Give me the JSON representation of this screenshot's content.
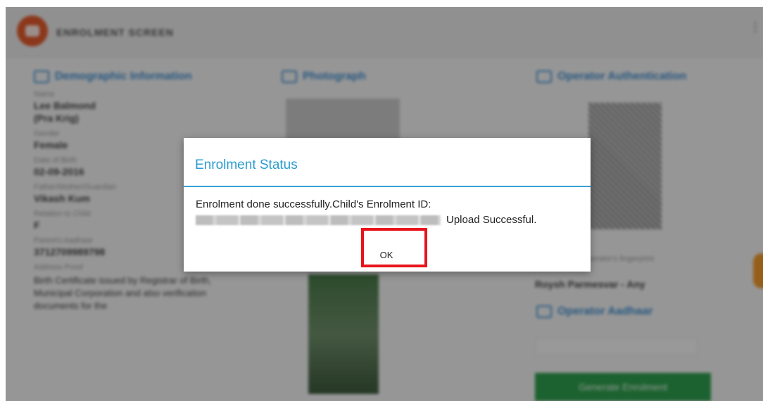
{
  "app": {
    "title": "ENROLMENT SCREEN"
  },
  "sections": {
    "demographic": {
      "heading": "Demographic Information",
      "fields": [
        {
          "label": "Name",
          "value": "Lee Balmond"
        },
        {
          "label": "",
          "value": "(Pra Krig)"
        },
        {
          "label": "Gender",
          "value": "Female"
        },
        {
          "label": "Date of Birth",
          "value": "02-09-2016"
        },
        {
          "label": "Father/Mother/Guardian",
          "value": "Vikash Kum"
        },
        {
          "label": "Relation to Child",
          "value": "F"
        },
        {
          "label": "Parent's Aadhaar",
          "value": "3712709989798"
        }
      ],
      "address_label": "Address Proof",
      "address_text": "Birth Certificate issued by Registrar of Birth, Municipal Corporation and also verification documents for the"
    },
    "photograph": {
      "heading": "Photograph"
    },
    "operator": {
      "heading": "Operator Authentication",
      "caption": "Operator's fingerprint",
      "name_line": "Roysh Parmesvar - Any",
      "supervisor_heading": "Operator Aadhaar",
      "supervisor_value": "",
      "button_label": "Generate Enrolment"
    }
  },
  "dialog": {
    "title": "Enrolment Status",
    "message_line1": "Enrolment done successfully.Child's Enrolment ID:",
    "message_line2_suffix": "Upload Successful.",
    "ok_label": "OK"
  },
  "colors": {
    "accent": "#2b9cd0",
    "highlight_box": "#e8141c",
    "app_logo": "#e25a2c",
    "primary_button": "#2e9f4e"
  },
  "icons": {
    "logo": "app-logo-icon",
    "menu": "overflow-menu-icon",
    "section": "section-icon"
  }
}
